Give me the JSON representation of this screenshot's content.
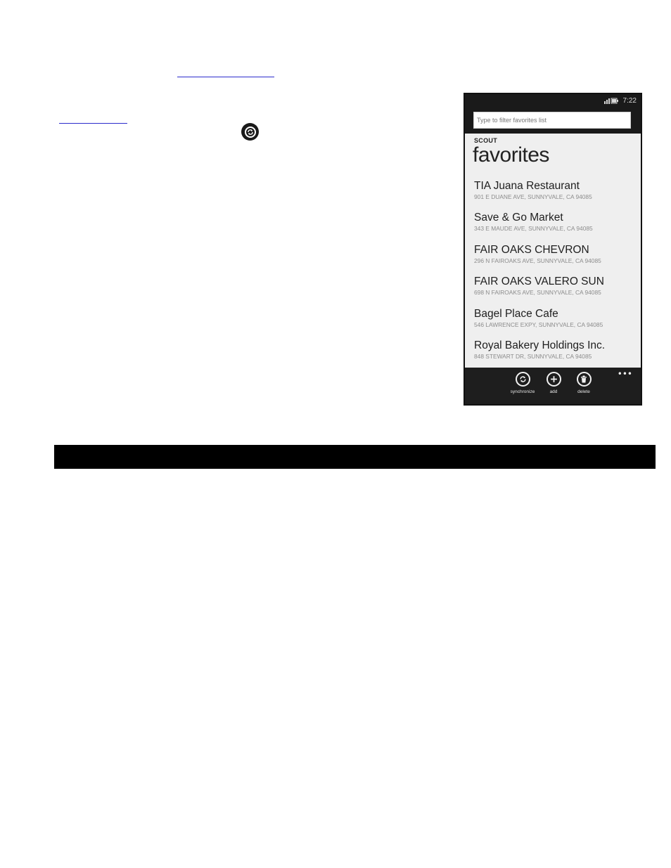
{
  "icons": {
    "inline_sync": "sync-icon",
    "status": "battery-signal-icon",
    "synchronize": "sync-icon",
    "add": "plus-icon",
    "delete": "trash-icon",
    "more": "more-dots-icon"
  },
  "phone": {
    "status": {
      "time": "7:22"
    },
    "filter": {
      "placeholder": "Type to filter favorites list"
    },
    "app_name": "SCOUT",
    "page_title": "favorites",
    "favorites": [
      {
        "name": "TIA Juana Restaurant",
        "address": "901 E DUANE AVE, SUNNYVALE, CA 94085"
      },
      {
        "name": "Save & Go Market",
        "address": "343 E MAUDE AVE, SUNNYVALE, CA 94085"
      },
      {
        "name": "FAIR OAKS CHEVRON",
        "address": "296 N FAIROAKS AVE, SUNNYVALE, CA 94085"
      },
      {
        "name": "FAIR OAKS VALERO SUN",
        "address": "698 N FAIROAKS AVE, SUNNYVALE, CA 94085"
      },
      {
        "name": "Bagel Place Cafe",
        "address": "546 LAWRENCE EXPY, SUNNYVALE, CA 94085"
      },
      {
        "name": "Royal Bakery Holdings Inc.",
        "address": "848 STEWART DR, SUNNYVALE, CA 94085"
      }
    ],
    "app_bar": {
      "synchronize_label": "synchronize",
      "add_label": "add",
      "delete_label": "delete",
      "more": "•••"
    }
  },
  "colors": {
    "link": "#2b2bcc",
    "phone_chrome": "#1a1a1a",
    "list_background": "#efefef"
  }
}
